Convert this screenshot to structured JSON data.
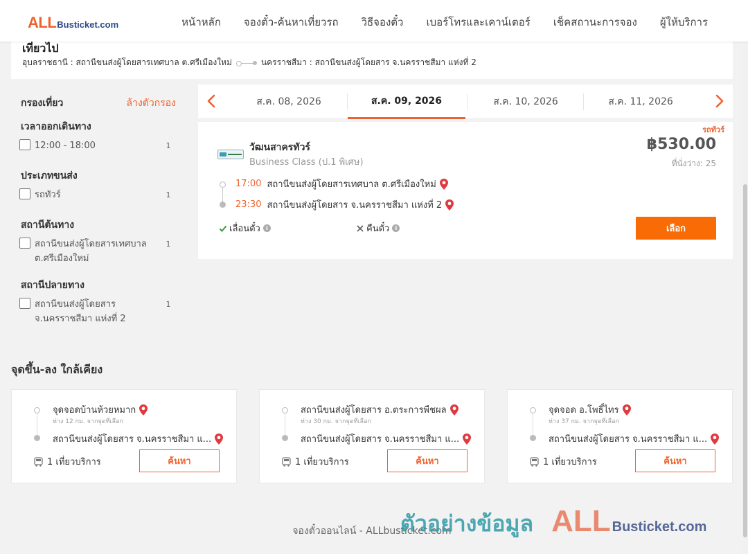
{
  "header": {
    "logo_big": "ALL",
    "logo_small": "Busticket.com",
    "nav": [
      "หน้าหลัก",
      "จองตั๋ว-ค้นหาเที่ยวรถ",
      "วิธีจองตั๋ว",
      "เบอร์โทรและเคาน์เตอร์",
      "เช็คสถานะการจอง",
      "ผู้ให้บริการ"
    ]
  },
  "route": {
    "title": "เที่ยวไป",
    "from": "อุบลราชธานี : สถานีขนส่งผู้โดยสารเทศบาล ต.ศรีเมืองใหม่",
    "to": "นครราชสีมา : สถานีขนส่งผู้โดยสาร จ.นครราชสีมา แห่งที่ 2"
  },
  "filters": {
    "title": "กรองเที่ยว",
    "clear": "ล้างตัวกรอง",
    "groups": [
      {
        "title": "เวลาออกเดินทาง",
        "options": [
          {
            "label": "12:00 - 18:00",
            "count": "1"
          }
        ]
      },
      {
        "title": "ประเภทขนส่ง",
        "options": [
          {
            "label": "รถทัวร์",
            "count": "1"
          }
        ]
      },
      {
        "title": "สถานีต้นทาง",
        "options": [
          {
            "label": "สถานีขนส่งผู้โดยสารเทศบาล ต.ศรีเมืองใหม่",
            "count": "1"
          }
        ]
      },
      {
        "title": "สถานีปลายทาง",
        "options": [
          {
            "label": "สถานีขนส่งผู้โดยสาร จ.นครราชสีมา แห่งที่ 2",
            "count": "1"
          }
        ]
      }
    ]
  },
  "dates": {
    "tabs": [
      "ส.ค. 08, 2026",
      "ส.ค. 09, 2026",
      "ส.ค. 10, 2026",
      "ส.ค. 11, 2026"
    ],
    "active_index": 1
  },
  "result": {
    "tag": "รถทัวร์",
    "operator": "วัฒนสาครทัวร์",
    "class": "Business Class (ป.1 พิเศษ)",
    "price": "฿530.00",
    "seats": "ที่นั่งว่าง: 25",
    "depart_time": "17:00",
    "depart_station": "สถานีขนส่งผู้โดยสารเทศบาล ต.ศรีเมืองใหม่",
    "arrive_time": "23:30",
    "arrive_station": "สถานีขนส่งผู้โดยสาร จ.นครราชสีมา แห่งที่ 2",
    "feature_reschedule": "เลื่อนตั๋ว",
    "feature_refund": "คืนตั๋ว",
    "select_label": "เลือก"
  },
  "nearby": {
    "title": "จุดขึ้น-ลง ใกล้เคียง",
    "cards": [
      {
        "from": "จุดจอดบ้านห้วยหมาก",
        "dist": "ห่าง 12 กม. จากจุดที่เลือก",
        "to": "สถานีขนส่งผู้โดยสาร จ.นครราชสีมา แ...",
        "trips": "1 เที่ยวบริการ",
        "button": "ค้นหา"
      },
      {
        "from": "สถานีขนส่งผู้โดยสาร อ.ตระการพืชผล",
        "dist": "ห่าง 30 กม. จากจุดที่เลือก",
        "to": "สถานีขนส่งผู้โดยสาร จ.นครราชสีมา แ...",
        "trips": "1 เที่ยวบริการ",
        "button": "ค้นหา"
      },
      {
        "from": "จุดจอด อ.โพธิ์ไทร",
        "dist": "ห่าง 37 กม. จากจุดที่เลือก",
        "to": "สถานีขนส่งผู้โดยสาร จ.นครราชสีมา แ...",
        "trips": "1 เที่ยวบริการ",
        "button": "ค้นหา"
      }
    ]
  },
  "footer": {
    "text": "จองตั๋วออนไลน์ - ALLbusticket.com"
  },
  "watermark": {
    "thai": "ตัวอย่างข้อมูล",
    "big": "ALL",
    "small": "Busticket.com"
  },
  "colors": {
    "accent": "#f0622d",
    "button": "#f96b05",
    "pin": "#e0393e",
    "check": "#3a9a3a"
  },
  "icons": [
    "chevron-left-icon",
    "chevron-right-icon",
    "map-pin-icon",
    "check-icon",
    "x-icon",
    "info-icon",
    "bus-icon"
  ]
}
